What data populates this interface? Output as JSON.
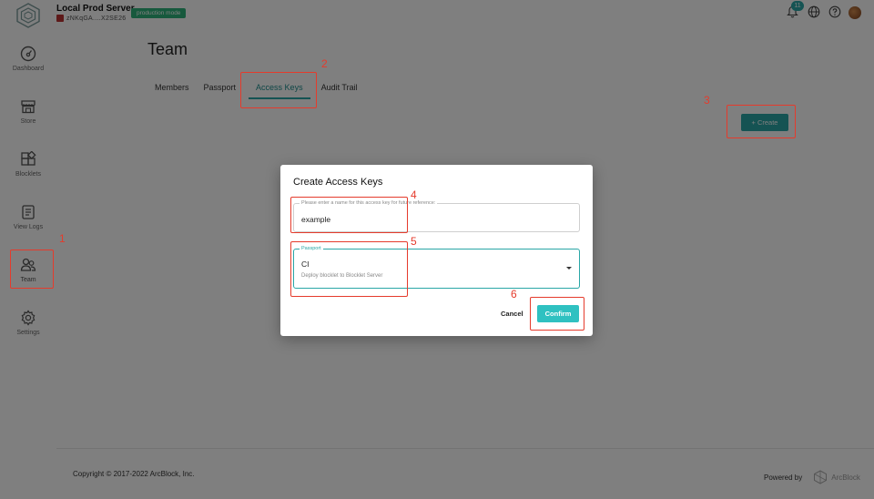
{
  "header": {
    "server_name": "Local Prod Server",
    "server_did": "zNKqGA....X2SE26",
    "mode_badge": "production mode",
    "notification_count": "11",
    "icons": [
      "bell-icon",
      "globe-icon",
      "help-icon",
      "user-avatar"
    ]
  },
  "sidebar": {
    "items": [
      {
        "label": "Dashboard",
        "icon": "dashboard-icon"
      },
      {
        "label": "Store",
        "icon": "store-icon"
      },
      {
        "label": "Blocklets",
        "icon": "blocklets-icon"
      },
      {
        "label": "View Logs",
        "icon": "logs-icon"
      },
      {
        "label": "Team",
        "icon": "team-icon",
        "active": true
      },
      {
        "label": "Settings",
        "icon": "gear-icon"
      }
    ]
  },
  "main": {
    "title": "Team",
    "tabs": [
      {
        "label": "Members"
      },
      {
        "label": "Passport"
      },
      {
        "label": "Access Keys",
        "active": true
      },
      {
        "label": "Audit Trail"
      }
    ],
    "create_label": "+ Create"
  },
  "dialog": {
    "title": "Create Access Keys",
    "name_field": {
      "label": "Please enter a name for this access key for future reference:",
      "value": "example"
    },
    "passport_field": {
      "label": "Passport",
      "value": "CI",
      "description": "Deploy blocklet to Blocklet Server"
    },
    "cancel_label": "Cancel",
    "confirm_label": "Confirm"
  },
  "footer": {
    "copyright": "Copyright © 2017-2022  ArcBlock, Inc.",
    "powered_by": "Powered by",
    "brand": "ArcBlock"
  },
  "annotations": {
    "labels": [
      "1",
      "2",
      "3",
      "4",
      "5",
      "6"
    ],
    "color": "#e53b2c"
  },
  "colors": {
    "accent": "#2aa6a6",
    "badge_green": "#2fb37a"
  }
}
